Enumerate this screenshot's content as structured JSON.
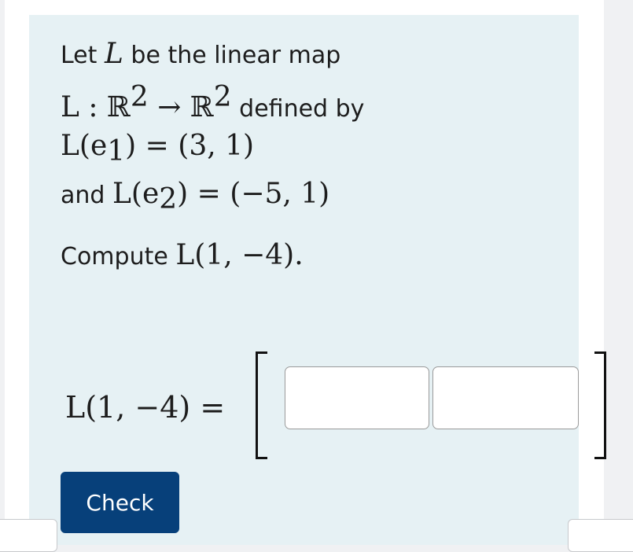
{
  "question": {
    "intro": "Let",
    "map_symbol": "L",
    "intro_rest": "be the linear map",
    "domain_line": {
      "map": "L : ℝ",
      "exp1": "2",
      "arrow": " → ℝ",
      "exp2": "2",
      "text": "defined by"
    },
    "e1_line": {
      "lhs": "L(e",
      "sub": "1",
      "rhs": ") = (3, 1)"
    },
    "e2_line": {
      "prefix": "and",
      "lhs": "L(e",
      "sub": "2",
      "rhs": ") = (−5, 1)"
    },
    "compute": {
      "text": "Compute",
      "expr": "L(1, −4)."
    }
  },
  "answer": {
    "label": "L(1, −4) =",
    "input1_value": "",
    "input2_value": ""
  },
  "check_button": {
    "label": "Check"
  }
}
